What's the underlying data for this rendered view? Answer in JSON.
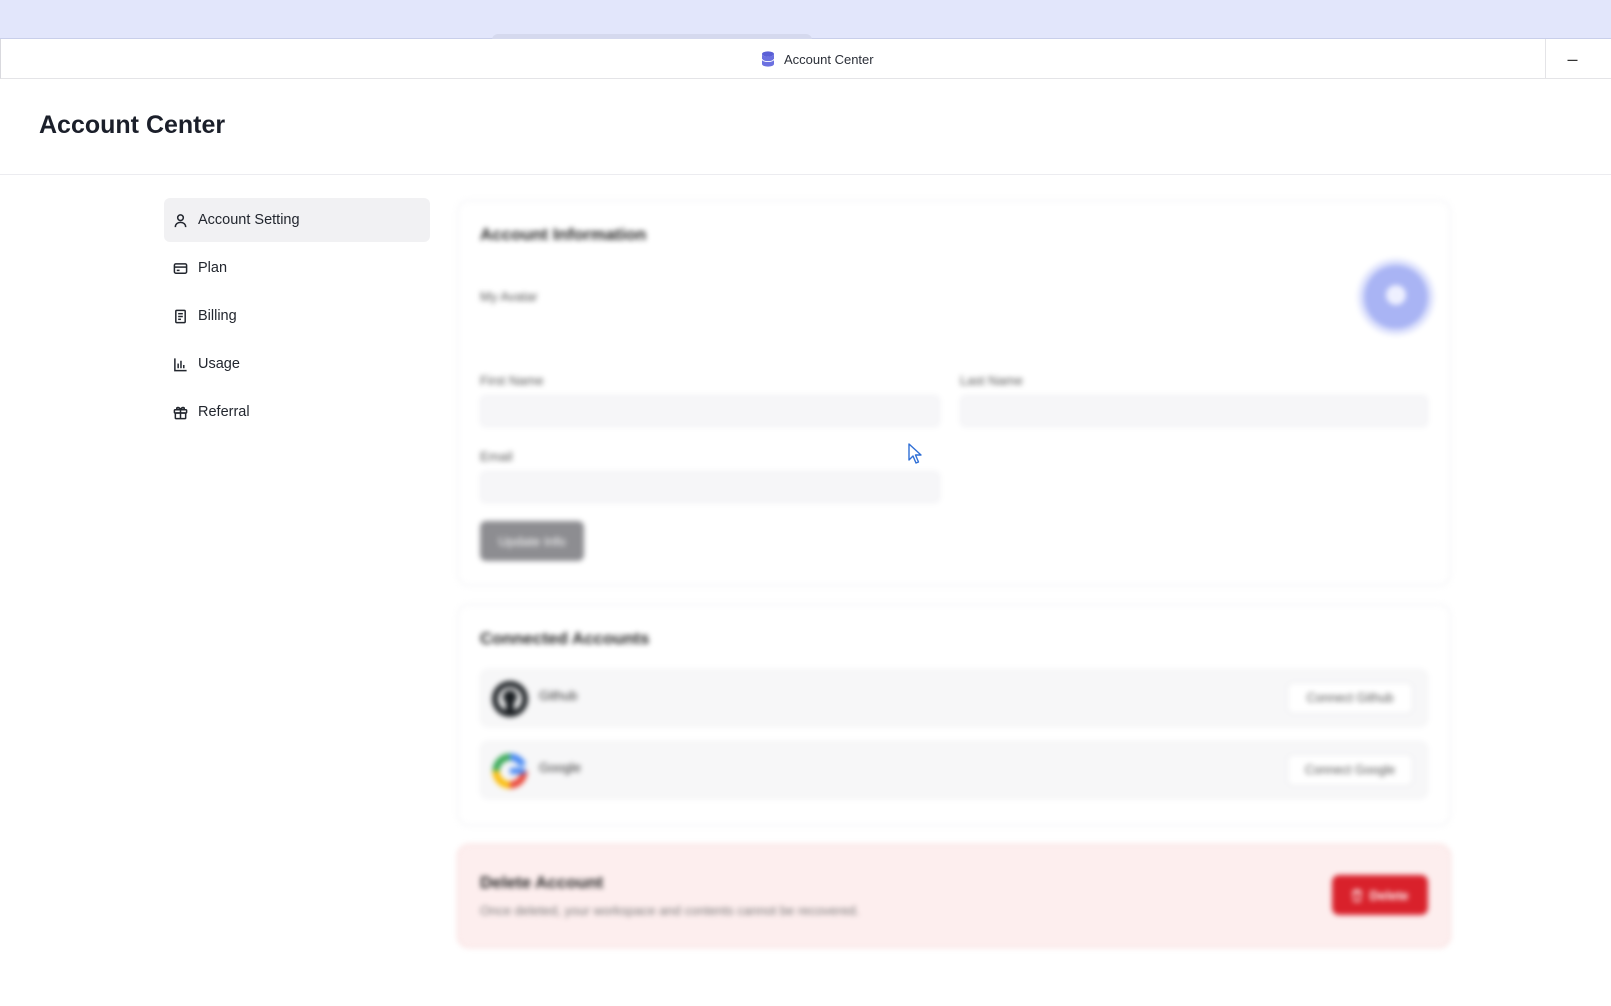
{
  "window": {
    "title": "Account Center",
    "minimize_label": "–"
  },
  "page": {
    "title": "Account Center"
  },
  "sidebar": {
    "items": [
      {
        "label": "Account Setting",
        "icon": "user-icon",
        "active": true
      },
      {
        "label": "Plan",
        "icon": "credit-card-icon",
        "active": false
      },
      {
        "label": "Billing",
        "icon": "receipt-icon",
        "active": false
      },
      {
        "label": "Usage",
        "icon": "bar-chart-icon",
        "active": false
      },
      {
        "label": "Referral",
        "icon": "gift-icon",
        "active": false
      }
    ]
  },
  "account_info": {
    "title": "Account Information",
    "avatar_label": "My Avatar",
    "first_name_label": "First Name",
    "last_name_label": "Last Name",
    "email_label": "Email",
    "update_button": "Update Info"
  },
  "connected_accounts": {
    "title": "Connected Accounts",
    "items": [
      {
        "name": "Github",
        "button": "Connect Github",
        "icon": "github-icon"
      },
      {
        "name": "Google",
        "button": "Connect Google",
        "icon": "google-icon"
      }
    ]
  },
  "danger": {
    "title": "Delete Account",
    "description": "Once deleted, your workspace and contents cannot be recovered.",
    "button": "Delete"
  },
  "colors": {
    "accent": "#a9b4f4",
    "danger": "#d9212b",
    "danger_bg": "#fdeeee",
    "top_strip": "#e2e6fb"
  }
}
